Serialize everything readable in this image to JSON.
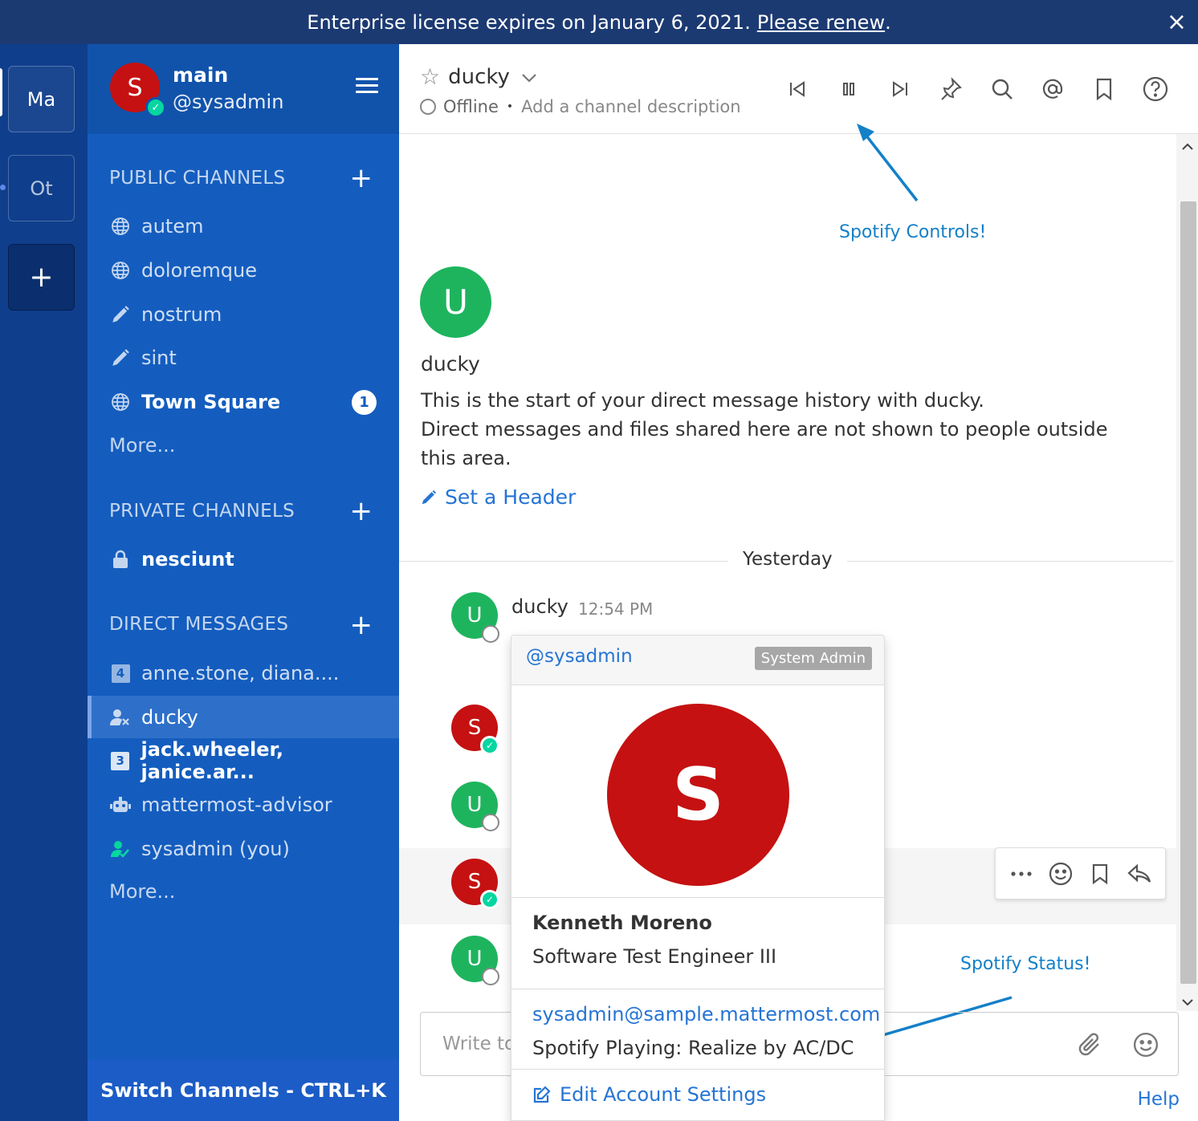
{
  "banner": {
    "text": "Enterprise license expires on January 6, 2021.",
    "link": "Please renew",
    "period": ".",
    "close": "×"
  },
  "teams": [
    {
      "label": "Ma"
    },
    {
      "label": "Ot"
    },
    {
      "label": "+"
    }
  ],
  "sidebar": {
    "team_name": "main",
    "username": "@sysadmin",
    "avatar_initial": "S",
    "sections": {
      "public": "PUBLIC CHANNELS",
      "private": "PRIVATE CHANNELS",
      "direct": "DIRECT MESSAGES"
    },
    "public_channels": [
      {
        "label": "autem",
        "icon": "globe-icon"
      },
      {
        "label": "doloremque",
        "icon": "globe-icon"
      },
      {
        "label": "nostrum",
        "icon": "pencil-icon"
      },
      {
        "label": "sint",
        "icon": "pencil-icon"
      },
      {
        "label": "Town Square",
        "icon": "globe-icon",
        "badge": "1"
      }
    ],
    "public_more": "More...",
    "private_channels": [
      {
        "label": "nesciunt",
        "icon": "lock-icon"
      }
    ],
    "direct_messages": [
      {
        "label": "anne.stone, diana....",
        "count": "4"
      },
      {
        "label": "ducky",
        "icon": "user-offline-icon"
      },
      {
        "label": "jack.wheeler, janice.ar...",
        "count": "3"
      },
      {
        "label": "mattermost-advisor",
        "icon": "bot-icon"
      },
      {
        "label": "sysadmin (you)",
        "icon": "user-online-icon"
      }
    ],
    "direct_more": "More...",
    "switch_channels": "Switch Channels - CTRL+K"
  },
  "header": {
    "channel_name": "ducky",
    "status": "Offline",
    "separator": "•",
    "description_placeholder": "Add a channel description"
  },
  "annotations": {
    "controls": "Spotify Controls!",
    "status": "Spotify Status!"
  },
  "intro": {
    "avatar_initial": "U",
    "name": "ducky",
    "line1": "This is the start of your direct message history with ducky.",
    "line2": "Direct messages and files shared here are not shown to people outside this area.",
    "set_header": "Set a Header"
  },
  "date_separator": "Yesterday",
  "post": {
    "user": "ducky",
    "time": "12:54 PM"
  },
  "avatars": {
    "u": "U",
    "s": "S"
  },
  "composer": {
    "placeholder": "Write to"
  },
  "help": "Help",
  "popover": {
    "handle": "@sysadmin",
    "role": "System Admin",
    "avatar_initial": "S",
    "full_name": "Kenneth Moreno",
    "position": "Software Test Engineer III",
    "email": "sysadmin@sample.mattermost.com",
    "spotify": "Spotify Playing: Realize by AC/DC",
    "edit": "Edit Account Settings"
  },
  "colors": {
    "banner": "#1c3a72",
    "sidebar": "#145dbf",
    "team_sidebar": "#0f3e8c",
    "link": "#2574d4",
    "online": "#06d6a0",
    "avatar_red": "#c51111",
    "avatar_green": "#1eb45e",
    "annotation": "#1480c8"
  }
}
